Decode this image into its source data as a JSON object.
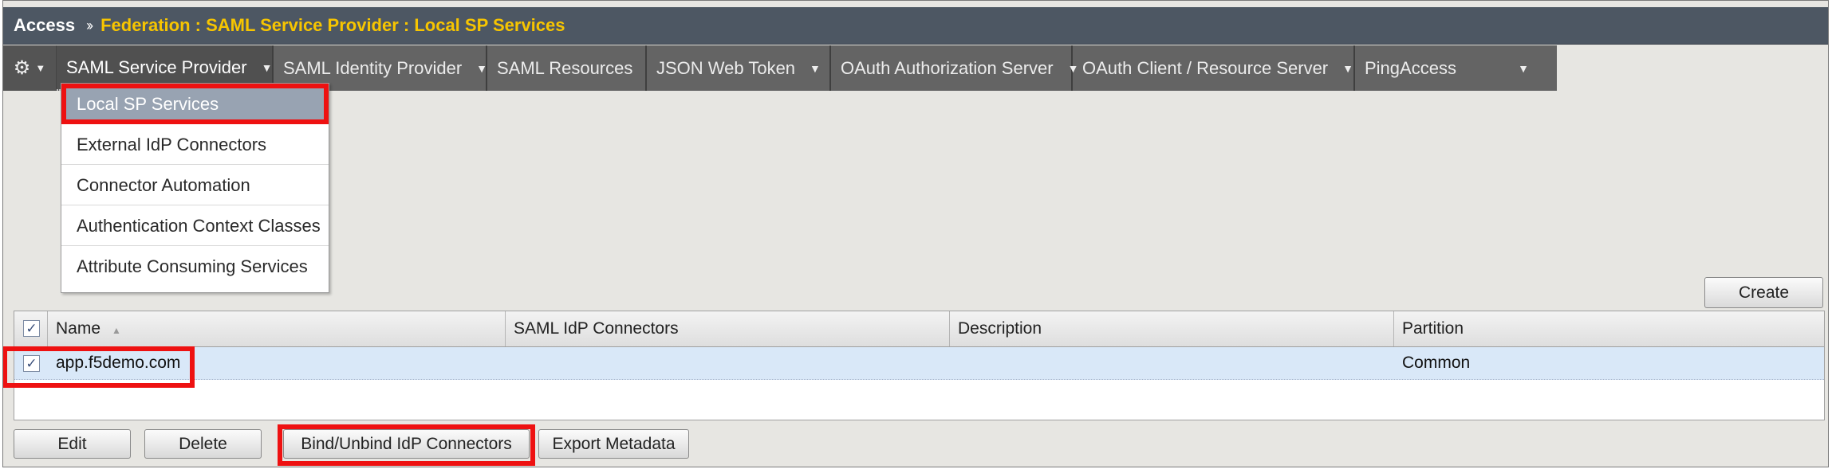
{
  "breadcrumb": {
    "root": "Access",
    "separator": "››",
    "path": "Federation : SAML Service Provider : Local SP Services"
  },
  "nav": {
    "gear_icon": "gear-icon",
    "tabs": [
      {
        "label": "SAML Service Provider",
        "has_menu": true
      },
      {
        "label": "SAML Identity Provider",
        "has_menu": true
      },
      {
        "label": "SAML Resources",
        "has_menu": false
      },
      {
        "label": "JSON Web Token",
        "has_menu": true
      },
      {
        "label": "OAuth Authorization Server",
        "has_menu": true
      },
      {
        "label": "OAuth Client / Resource Server",
        "has_menu": true
      },
      {
        "label": "PingAccess",
        "has_menu": true
      }
    ],
    "dropdown": [
      {
        "label": "Local SP Services"
      },
      {
        "label": "External IdP Connectors"
      },
      {
        "label": "Connector Automation"
      },
      {
        "label": "Authentication Context Classes"
      },
      {
        "label": "Attribute Consuming Services"
      }
    ]
  },
  "toolbar": {
    "create_label": "Create"
  },
  "table": {
    "columns": [
      "Name",
      "SAML IdP Connectors",
      "Description",
      "Partition"
    ],
    "rows": [
      {
        "name": "app.f5demo.com",
        "saml_idp_connectors": "",
        "description": "",
        "partition": "Common",
        "checked": true
      }
    ]
  },
  "actions": {
    "edit": "Edit",
    "delete": "Delete",
    "bind": "Bind/Unbind IdP Connectors",
    "export": "Export Metadata"
  },
  "colors": {
    "highlight": "#ee1111",
    "title_path": "#f7c500",
    "titlebar": "#4d5763",
    "selected_row": "#d9e8f8"
  }
}
